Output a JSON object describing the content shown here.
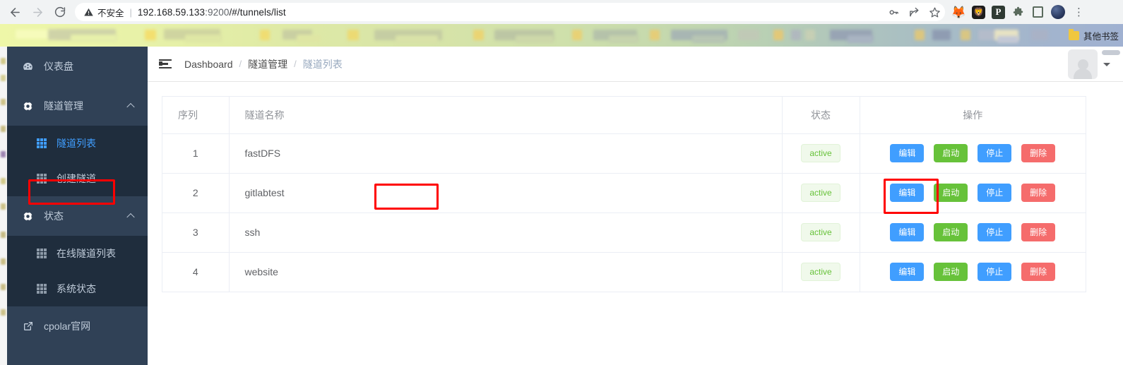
{
  "browser": {
    "back_icon": "back-arrow-icon",
    "forward_icon": "forward-arrow-icon",
    "reload_icon": "reload-icon",
    "security_label": "不安全",
    "url": "192.168.59.133:9200/#/tunnels/list",
    "url_host": "192.168.59.133",
    "url_port": ":9200",
    "url_path": "/#/tunnels/list",
    "omnibox_icons": [
      "password-key-icon",
      "share-icon",
      "bookmark-star-icon"
    ],
    "extensions": [
      {
        "name": "metamask-extension-icon",
        "glyph": "🦊"
      },
      {
        "name": "bitkeep-extension-icon",
        "glyph": "🦁"
      },
      {
        "name": "pocket-extension-icon",
        "glyph": "P"
      },
      {
        "name": "extensions-puzzle-icon",
        "glyph": "❖"
      },
      {
        "name": "sidepanel-icon",
        "glyph": ""
      }
    ],
    "profile_icon": "profile-avatar-icon",
    "menu_icon": "chrome-menu-kebab-icon",
    "bookmarks": {
      "other_bookmarks_label": "其他书签",
      "folder_icon": "bookmark-folder-icon"
    }
  },
  "sidebar": {
    "items": [
      {
        "label": "仪表盘",
        "icon": "dashboard-icon",
        "type": "item",
        "active": false
      },
      {
        "label": "隧道管理",
        "icon": "tunnel-icon",
        "type": "group",
        "expanded": true,
        "children": [
          {
            "label": "隧道列表",
            "icon": "grid-icon",
            "active": true
          },
          {
            "label": "创建隧道",
            "icon": "grid-icon",
            "active": false
          }
        ]
      },
      {
        "label": "状态",
        "icon": "status-icon",
        "type": "group",
        "expanded": true,
        "children": [
          {
            "label": "在线隧道列表",
            "icon": "grid-icon",
            "active": false
          },
          {
            "label": "系统状态",
            "icon": "grid-icon",
            "active": false
          }
        ]
      },
      {
        "label": "cpolar官网",
        "icon": "external-link-icon",
        "type": "item",
        "active": false
      }
    ]
  },
  "topbar": {
    "collapse_icon": "sidebar-collapse-icon",
    "breadcrumb": [
      "Dashboard",
      "隧道管理",
      "隧道列表"
    ],
    "breadcrumb_separator": "/",
    "avatar_icon": "user-avatar-icon",
    "caret_icon": "chevron-down-icon"
  },
  "table": {
    "headers": [
      "序列",
      "隧道名称",
      "状态",
      "操作"
    ],
    "rows": [
      {
        "index": "1",
        "name": "fastDFS",
        "status": "active"
      },
      {
        "index": "2",
        "name": "gitlabtest",
        "status": "active"
      },
      {
        "index": "3",
        "name": "ssh",
        "status": "active"
      },
      {
        "index": "4",
        "name": "website",
        "status": "active"
      }
    ],
    "actions": {
      "edit": "编辑",
      "start": "启动",
      "stop": "停止",
      "delete": "删除"
    }
  },
  "colors": {
    "sidebar_bg": "#304156",
    "submenu_bg": "#1f2d3d",
    "accent_blue": "#409EFF",
    "success_green": "#67C23A",
    "danger_red": "#F56C6C",
    "highlight_red": "#FF0000",
    "badge_bg": "#F0F9EB"
  },
  "annotations": {
    "highlight_tunnel_name": "fastDFS",
    "highlight_edit_button": "编辑",
    "highlight_sidebar_item": "隧道列表"
  }
}
